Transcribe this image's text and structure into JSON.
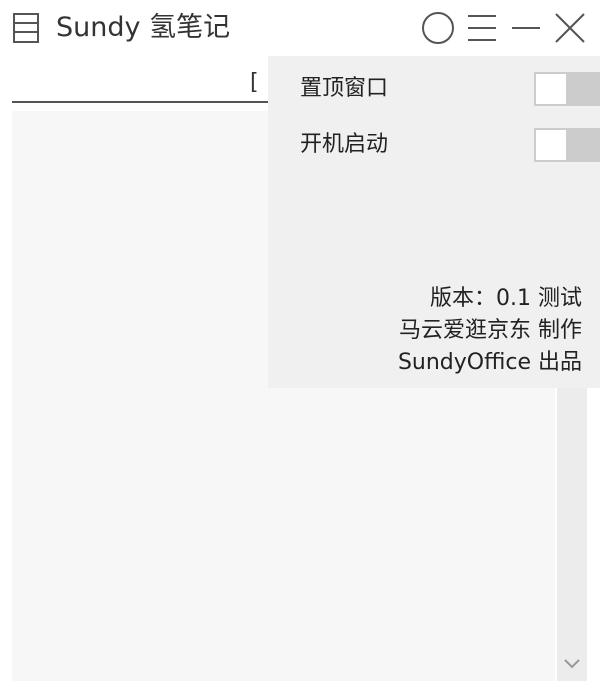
{
  "window": {
    "title": "Sundy 氢笔记",
    "icons": {
      "app": "notebook-icon",
      "pin": "circle-icon",
      "menu": "menu-icon",
      "minimize": "minimize-icon",
      "close": "close-icon"
    }
  },
  "tab": {
    "label": "["
  },
  "settings": {
    "items": [
      {
        "label": "置顶窗口",
        "enabled": false
      },
      {
        "label": "开机启动",
        "enabled": false
      }
    ],
    "about": {
      "version": "版本：0.1 测试",
      "author": "马云爱逛京东 制作",
      "publisher": "SundyOffice 出品"
    }
  },
  "colors": {
    "panel": "#f0f0f0",
    "editor": "#f7f7f7",
    "toggle_off": "#cccccc"
  }
}
